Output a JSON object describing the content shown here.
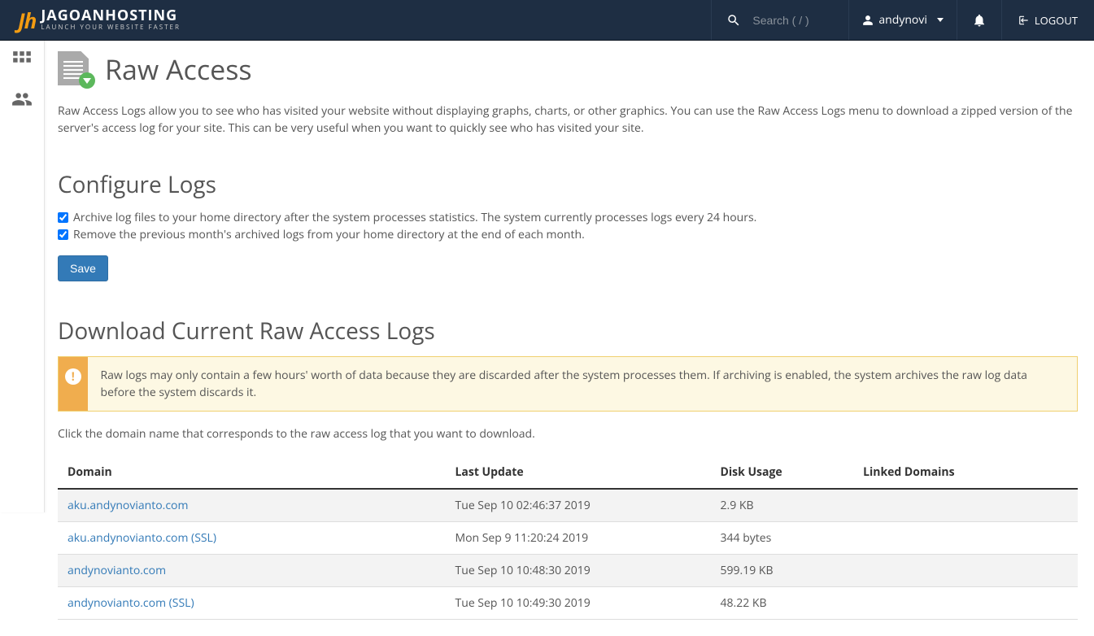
{
  "brand": {
    "name": "JAGOANHOSTING",
    "tagline": "LAUNCH YOUR WEBSITE FASTER"
  },
  "topbar": {
    "search_placeholder": "Search ( / )",
    "username": "andynovi",
    "logout_label": "LOGOUT"
  },
  "page": {
    "title": "Raw Access",
    "intro": "Raw Access Logs allow you to see who has visited your website without displaying graphs, charts, or other graphics. You can use the Raw Access Logs menu to download a zipped version of the server's access log for your site. This can be very useful when you want to quickly see who has visited your site."
  },
  "configure": {
    "heading": "Configure Logs",
    "opt_archive": "Archive log files to your home directory after the system processes statistics. The system currently processes logs every 24 hours.",
    "opt_remove": "Remove the previous month's archived logs from your home directory at the end of each month.",
    "save_label": "Save"
  },
  "download": {
    "heading": "Download Current Raw Access Logs",
    "warning": "Raw logs may only contain a few hours' worth of data because they are discarded after the system processes them. If archiving is enabled, the system archives the raw log data before the system discards it.",
    "hint": "Click the domain name that corresponds to the raw access log that you want to download.",
    "columns": {
      "domain": "Domain",
      "update": "Last Update",
      "disk": "Disk Usage",
      "linked": "Linked Domains"
    },
    "rows": [
      {
        "domain": "aku.andynovianto.com",
        "update": "Tue Sep 10 02:46:37 2019",
        "disk": "2.9 KB",
        "linked": ""
      },
      {
        "domain": "aku.andynovianto.com (SSL)",
        "update": "Mon Sep 9 11:20:24 2019",
        "disk": "344 bytes",
        "linked": ""
      },
      {
        "domain": "andynovianto.com",
        "update": "Tue Sep 10 10:48:30 2019",
        "disk": "599.19 KB",
        "linked": ""
      },
      {
        "domain": "andynovianto.com (SSL)",
        "update": "Tue Sep 10 10:49:30 2019",
        "disk": "48.22 KB",
        "linked": ""
      }
    ]
  }
}
